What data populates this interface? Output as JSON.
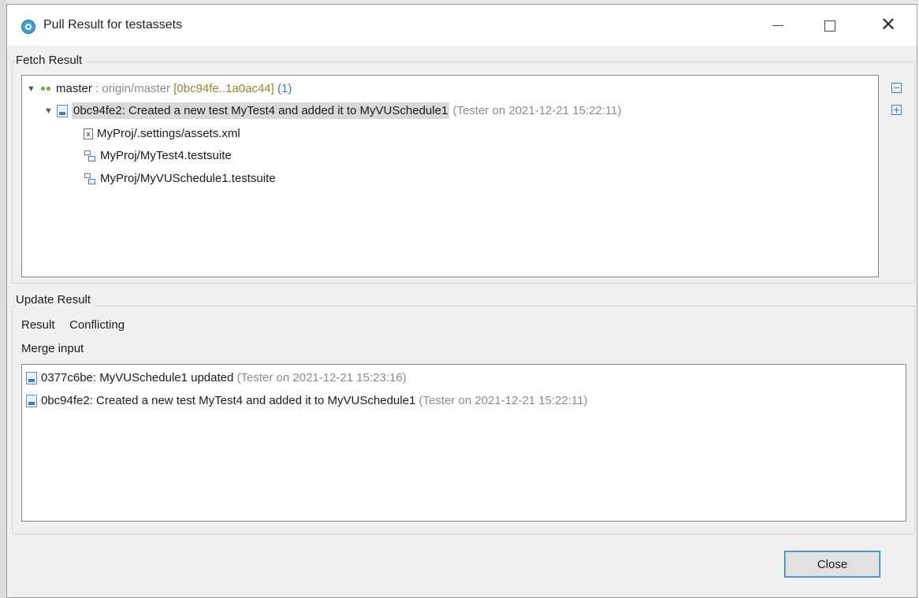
{
  "window": {
    "title": "Pull Result for testassets",
    "controls": {
      "minimize": "",
      "maximize": "",
      "close": "✕"
    }
  },
  "fetch": {
    "label": "Fetch Result",
    "branch": {
      "name": "master",
      "remote": " : origin/master",
      "range": " [0bc94fe..1a0ac44]",
      "count": " (1)"
    },
    "commit": {
      "text": "0bc94fe2: Created a new test MyTest4 and added it to MyVUSchedule1",
      "author": " (Tester",
      "date": " on 2021-12-21 15:22:11)"
    },
    "files": [
      {
        "icon": "xml-file-icon",
        "name": "MyProj/.settings/assets.xml"
      },
      {
        "icon": "testsuite-icon",
        "name": "MyProj/MyTest4.testsuite"
      },
      {
        "icon": "testsuite-icon",
        "name": "MyProj/MyVUSchedule1.testsuite"
      }
    ]
  },
  "update": {
    "label": "Update Result",
    "result_label": "Result",
    "result_value": "Conflicting",
    "merge_label": "Merge input",
    "merge_items": [
      {
        "text": "0377c6be: MyVUSchedule1 updated",
        "author": " (Tester",
        "date": " on 2021-12-21 15:23:16)"
      },
      {
        "text": "0bc94fe2: Created a new test MyTest4 and added it to MyVUSchedule1",
        "author": " (Tester",
        "date": " on 2021-12-21 15:22:11)"
      }
    ]
  },
  "buttons": {
    "close": "Close"
  },
  "colors": {
    "accent": "#1a7fd1",
    "branch": "#6a9f3a",
    "range": "#a07f2c",
    "count": "#2b7fc4",
    "secondary": "#8b8b8b"
  }
}
